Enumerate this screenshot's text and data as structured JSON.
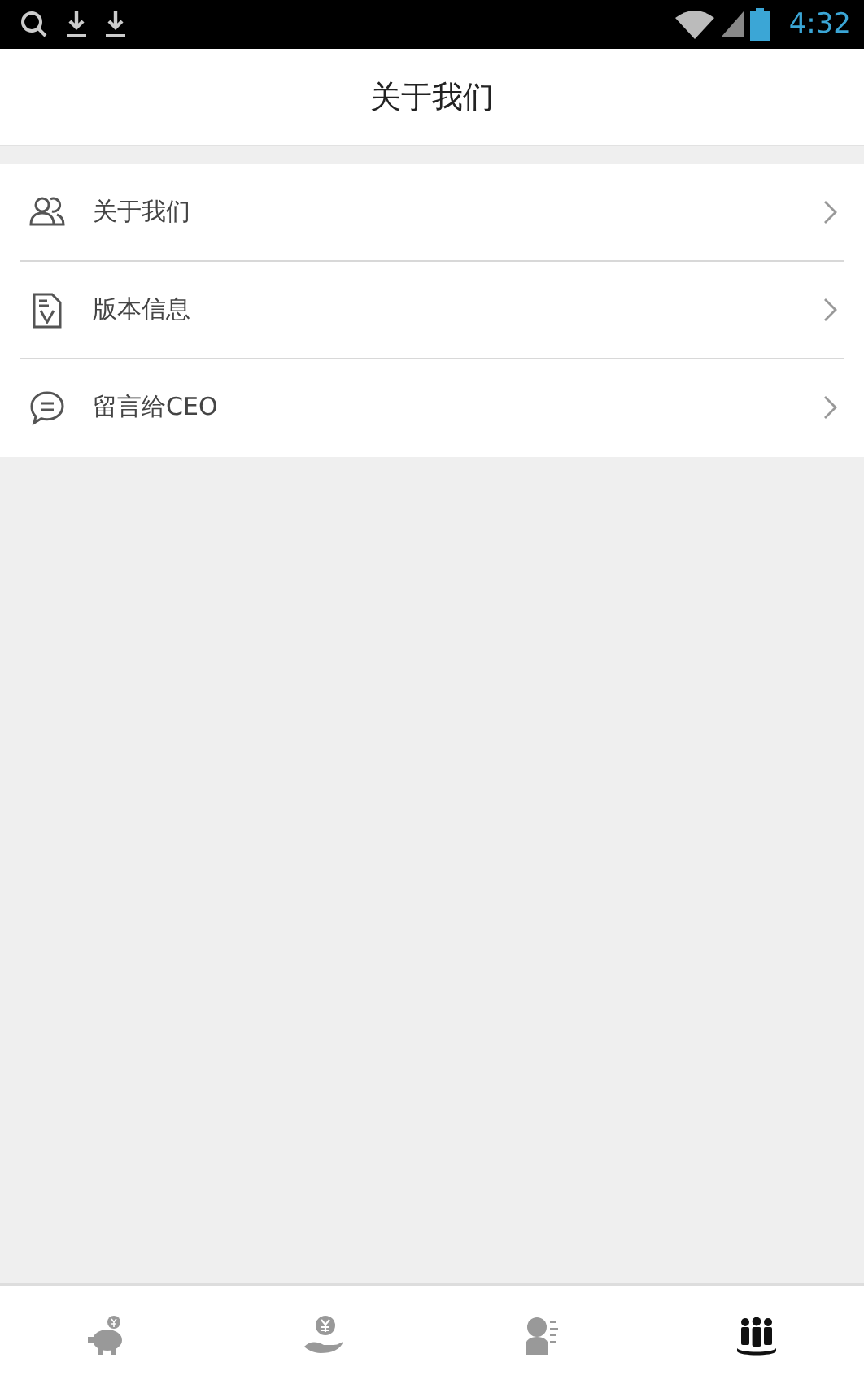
{
  "status_bar": {
    "time": "4:32"
  },
  "header": {
    "title": "关于我们"
  },
  "menu": [
    {
      "kind": "people",
      "label": "关于我们"
    },
    {
      "kind": "document",
      "label": "版本信息"
    },
    {
      "kind": "chat",
      "label": "留言给CEO"
    }
  ],
  "tabs": [
    {
      "kind": "piggy",
      "selected": false
    },
    {
      "kind": "hand",
      "selected": false
    },
    {
      "kind": "person",
      "selected": false
    },
    {
      "kind": "team",
      "selected": true
    }
  ]
}
